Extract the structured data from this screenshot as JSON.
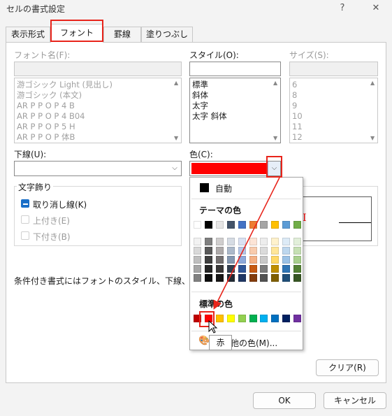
{
  "window": {
    "title": "セルの書式設定",
    "help_label": "?",
    "close_label": "✕"
  },
  "tabs": [
    {
      "label": "表示形式"
    },
    {
      "label": "フォント"
    },
    {
      "label": "罫線"
    },
    {
      "label": "塗りつぶし"
    }
  ],
  "font_name": {
    "label": "フォント名(F):",
    "items": [
      "游ゴシック Light (見出し)",
      "游ゴシック (本文)",
      "AR P P O P 4 B",
      "AR P P O P 4 B04",
      "AR P P O P 5 H",
      "AR P P O P 体B"
    ]
  },
  "style": {
    "label": "スタイル(O):",
    "items": [
      "標準",
      "斜体",
      "太字",
      "太字 斜体"
    ]
  },
  "size": {
    "label": "サイズ(S):",
    "items": [
      "6",
      "8",
      "9",
      "10",
      "11",
      "12"
    ]
  },
  "underline": {
    "label": "下線(U):",
    "value": ""
  },
  "color": {
    "label": "色(C):",
    "selected_hex": "#ff0000"
  },
  "effects": {
    "label": "文字飾り",
    "strikethrough": {
      "label": "取り消し線(K)",
      "checked": true
    },
    "superscript": {
      "label": "上付き(E)",
      "checked": false
    },
    "subscript": {
      "label": "下付き(B)",
      "checked": false
    }
  },
  "preview_text": "I",
  "note_text": "条件付き書式にはフォントのスタイル、下線、色、および",
  "color_popup": {
    "automatic_label": "自動",
    "theme_heading": "テーマの色",
    "standard_heading": "標準の色",
    "more_colors_label": "その他の色(M)...",
    "theme_top": [
      "#ffffff",
      "#000000",
      "#e7e6e6",
      "#44546a",
      "#4472c4",
      "#ed7d31",
      "#a5a5a5",
      "#ffc000",
      "#5b9bd5",
      "#70ad47"
    ],
    "theme_shades": [
      [
        "#f2f2f2",
        "#7f7f7f",
        "#d0cece",
        "#d6dce4",
        "#d9e1f2",
        "#fce4d6",
        "#ededed",
        "#fff2cc",
        "#ddebf7",
        "#e2efda"
      ],
      [
        "#d9d9d9",
        "#595959",
        "#aeaaaa",
        "#acb9ca",
        "#b4c6e7",
        "#f8cbad",
        "#dbdbdb",
        "#ffe699",
        "#bdd7ee",
        "#c6e0b4"
      ],
      [
        "#bfbfbf",
        "#404040",
        "#747070",
        "#8497b0",
        "#8ea9db",
        "#f4b084",
        "#c9c9c9",
        "#ffd966",
        "#9bc2e6",
        "#a9d08e"
      ],
      [
        "#a6a6a6",
        "#262626",
        "#3a3838",
        "#333f4f",
        "#2f5597",
        "#c65911",
        "#7b7b7b",
        "#bf8f00",
        "#2f75b5",
        "#548235"
      ],
      [
        "#808080",
        "#0d0d0d",
        "#171616",
        "#222b35",
        "#203764",
        "#833c0c",
        "#525252",
        "#806000",
        "#1f4e78",
        "#375623"
      ]
    ],
    "standard": [
      "#c00000",
      "#ff0000",
      "#ffc000",
      "#ffff00",
      "#92d050",
      "#00b050",
      "#00b0f0",
      "#0070c0",
      "#002060",
      "#7030a0"
    ],
    "tooltip": "赤"
  },
  "buttons": {
    "clear_label": "クリア(R)",
    "ok_label": "OK",
    "cancel_label": "キャンセル"
  }
}
